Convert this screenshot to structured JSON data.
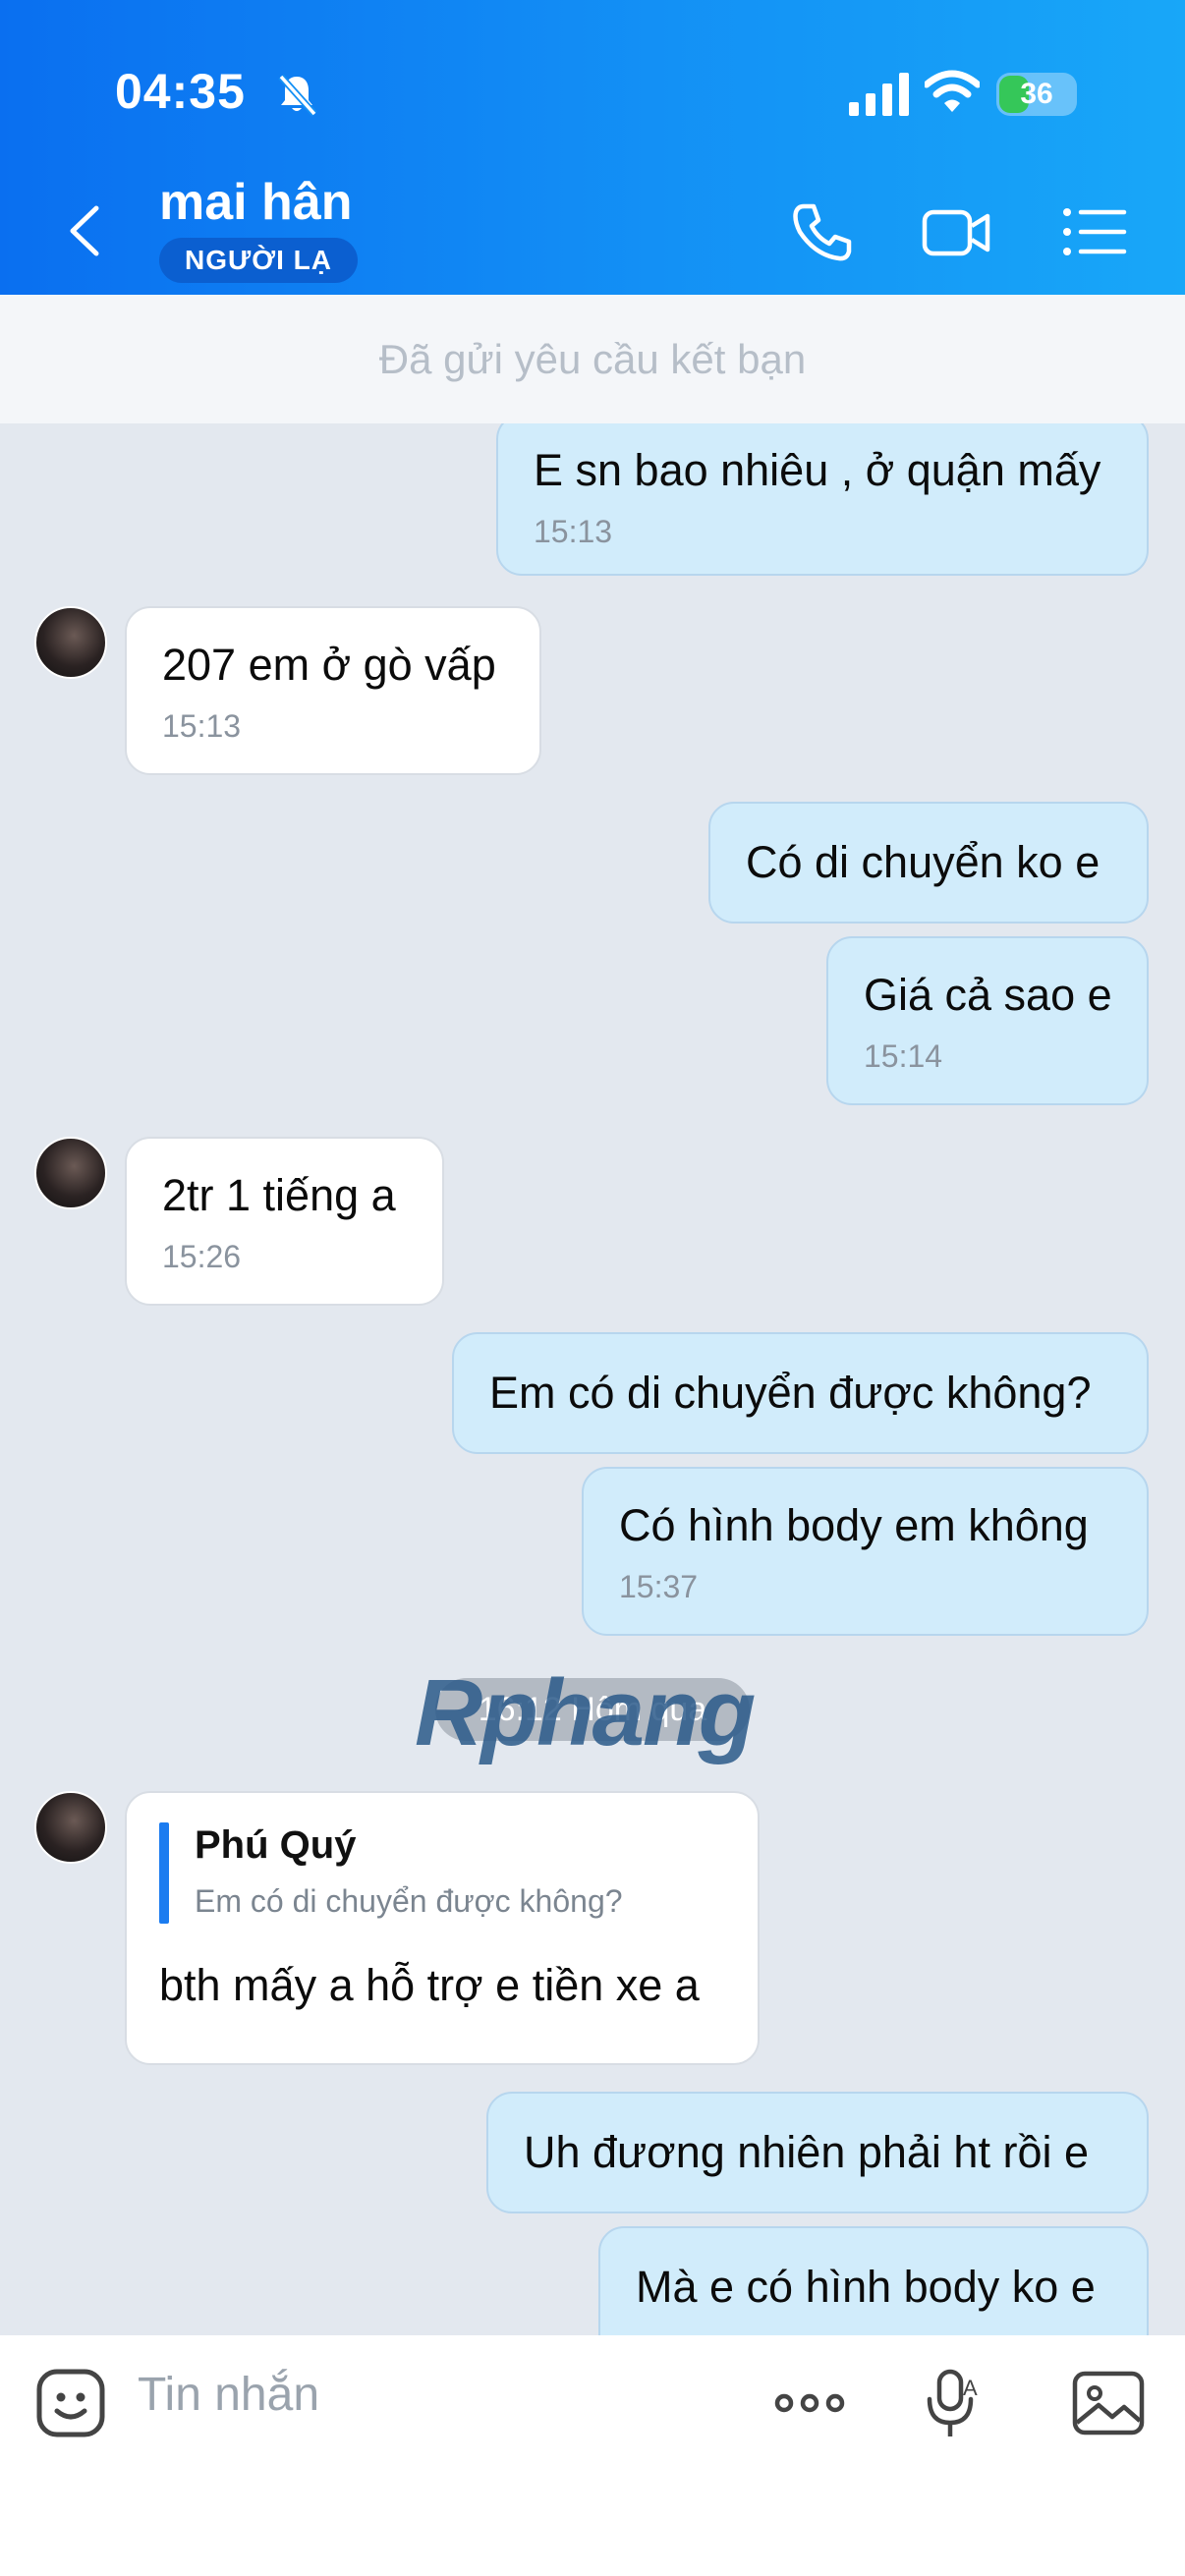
{
  "status_bar": {
    "time": "04:35",
    "battery": "36"
  },
  "header": {
    "name": "mai hân",
    "badge": "NGƯỜI LẠ"
  },
  "request_bar": {
    "text": "Đã gửi yêu cầu kết bạn"
  },
  "messages": [
    {
      "dir": "out",
      "text": "E sn bao nhiêu , ở quận mấy",
      "time": "15:13"
    },
    {
      "dir": "in",
      "text": "207 em ở gò vấp",
      "time": "15:13"
    },
    {
      "dir": "out",
      "text": "Có di chuyển ko e",
      "time": ""
    },
    {
      "dir": "out",
      "text": "Giá cả sao e",
      "time": "15:14"
    },
    {
      "dir": "in",
      "text": "2tr 1 tiếng a",
      "time": "15:26"
    },
    {
      "dir": "out",
      "text": "Em có di chuyển được không?",
      "time": ""
    },
    {
      "dir": "out",
      "text": "Có hình body em không",
      "time": "15:37"
    },
    {
      "dir": "in",
      "text": "bth mấy a hỗ trợ e tiền xe a",
      "time": "",
      "reply_to": {
        "name": "Phú Quý",
        "text": "Em có di chuyển được không?"
      }
    },
    {
      "dir": "out",
      "text": "Uh đương nhiên phải ht rồi e",
      "time": ""
    },
    {
      "dir": "out",
      "text": "Mà e có hình body ko e",
      "time": ""
    }
  ],
  "date_separator": "16:12 Hôm qua",
  "watermark": "Rphang",
  "input": {
    "placeholder": "Tin nhắn"
  },
  "colors": {
    "header_start": "#0a6ff0",
    "header_end": "#18a7f8",
    "bubble_out": "#d1ecfb",
    "bubble_in": "#ffffff",
    "chat_bg": "#e3e8ef"
  },
  "icons": [
    "back-icon",
    "phone-icon",
    "video-icon",
    "menu-icon",
    "sticker-icon",
    "more-icon",
    "mic-icon",
    "image-icon",
    "bell-off-icon",
    "signal-icon",
    "wifi-icon"
  ]
}
